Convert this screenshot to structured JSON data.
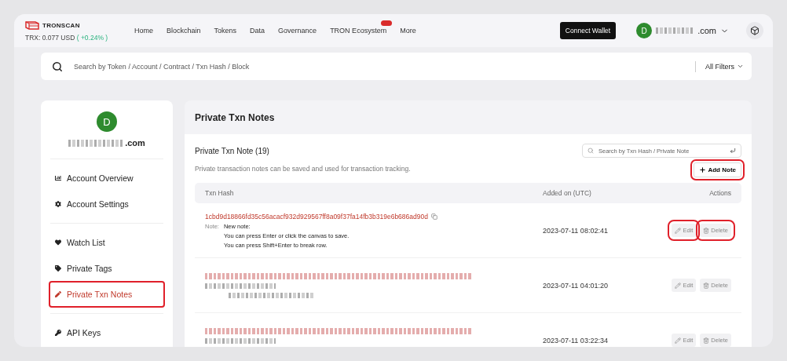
{
  "header": {
    "logo": "TRONSCAN",
    "price": "TRX: 0.077 USD",
    "change": "( +0.24% )",
    "nav": [
      {
        "label": "Home",
        "badge": false
      },
      {
        "label": "Blockchain",
        "badge": false
      },
      {
        "label": "Tokens",
        "badge": false
      },
      {
        "label": "Data",
        "badge": false
      },
      {
        "label": "Governance",
        "badge": false
      },
      {
        "label": "TRON Ecosystem",
        "badge": true
      },
      {
        "label": "More",
        "badge": false
      }
    ],
    "connect_button": "Connect Wallet",
    "avatar": "D",
    "email_suffix": ".com"
  },
  "search": {
    "placeholder": "Search by Token / Account / Contract / Txn Hash / Block",
    "filter": "All Filters"
  },
  "sidebar": {
    "avatar": "D",
    "email_suffix": ".com",
    "groups": [
      [
        {
          "label": "Account Overview",
          "kind": "chart",
          "selected": false,
          "highlighted": false
        },
        {
          "label": "Account Settings",
          "kind": "gear",
          "selected": false,
          "highlighted": false
        }
      ],
      [
        {
          "label": "Watch List",
          "kind": "heart",
          "selected": false,
          "highlighted": false
        },
        {
          "label": "Private Tags",
          "kind": "tag",
          "selected": false,
          "highlighted": false
        },
        {
          "label": "Private Txn Notes",
          "kind": "pen",
          "selected": true,
          "highlighted": true
        }
      ],
      [
        {
          "label": "API Keys",
          "kind": "key",
          "selected": false,
          "highlighted": false
        }
      ]
    ]
  },
  "main": {
    "title": "Private Txn Notes",
    "subtitle": "Private Txn Note (19)",
    "description": "Private transaction notes can be saved and used for transaction tracking.",
    "search_placeholder": "Search by Txn Hash / Private Note",
    "add_button": {
      "label": "Add Note",
      "highlighted": true
    },
    "table": {
      "columns": [
        "Txn Hash",
        "Added on (UTC)",
        "Actions"
      ],
      "rows": [
        {
          "redacted": false,
          "hash": "1cbd9d18866fd35c56acacf932d929567ff8a09f37fa14fb3b319e6b686ad90d",
          "note_label": "Note:",
          "note_lines": [
            "New note:",
            "You can press Enter or click the canvas to save.",
            "You can press Shift+Enter to break row."
          ],
          "added": "2023-07-11 08:02:41",
          "actions": [
            {
              "kind": "edit",
              "label": "Edit",
              "highlighted": true
            },
            {
              "kind": "delete",
              "label": "Delete",
              "highlighted": true
            }
          ]
        },
        {
          "redacted": true,
          "added": "2023-07-11 04:01:20",
          "actions": [
            {
              "kind": "edit",
              "label": "Edit",
              "highlighted": false
            },
            {
              "kind": "delete",
              "label": "Delete",
              "highlighted": false
            }
          ]
        },
        {
          "redacted": true,
          "added": "2023-07-11 03:22:34",
          "actions": [
            {
              "kind": "edit",
              "label": "Edit",
              "highlighted": false
            },
            {
              "kind": "delete",
              "label": "Delete",
              "highlighted": false
            }
          ]
        }
      ]
    }
  }
}
